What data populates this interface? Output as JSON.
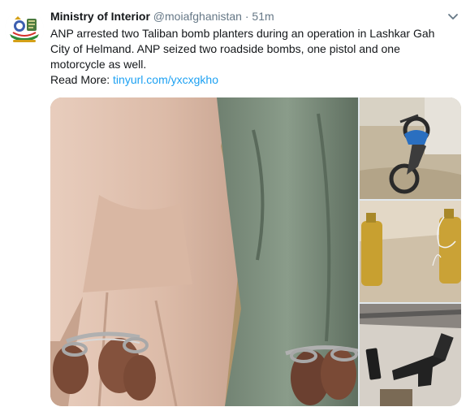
{
  "tweet": {
    "author_name": "Ministry of Interior",
    "author_handle": "@moiafghanistan",
    "separator": "·",
    "time": "51m",
    "text": "ANP arrested two Taliban bomb planters during an operation in Lashkar Gah City of Helmand. ANP seized two roadside bombs, one pistol and one motorcycle as well.",
    "read_more_label": "Read More:",
    "link_text": "tinyurl.com/yxcxgkho"
  },
  "icons": {
    "avatar": "ministry-logo-icon",
    "menu": "chevron-down-icon"
  },
  "colors": {
    "link": "#1da1f2",
    "secondary_text": "#657786",
    "primary_text": "#14171a"
  },
  "media": {
    "photo_count": 4,
    "photos": [
      {
        "subject": "handcuffed-suspects"
      },
      {
        "subject": "motorcycle"
      },
      {
        "subject": "roadside-bomb-containers"
      },
      {
        "subject": "pistol"
      }
    ]
  }
}
